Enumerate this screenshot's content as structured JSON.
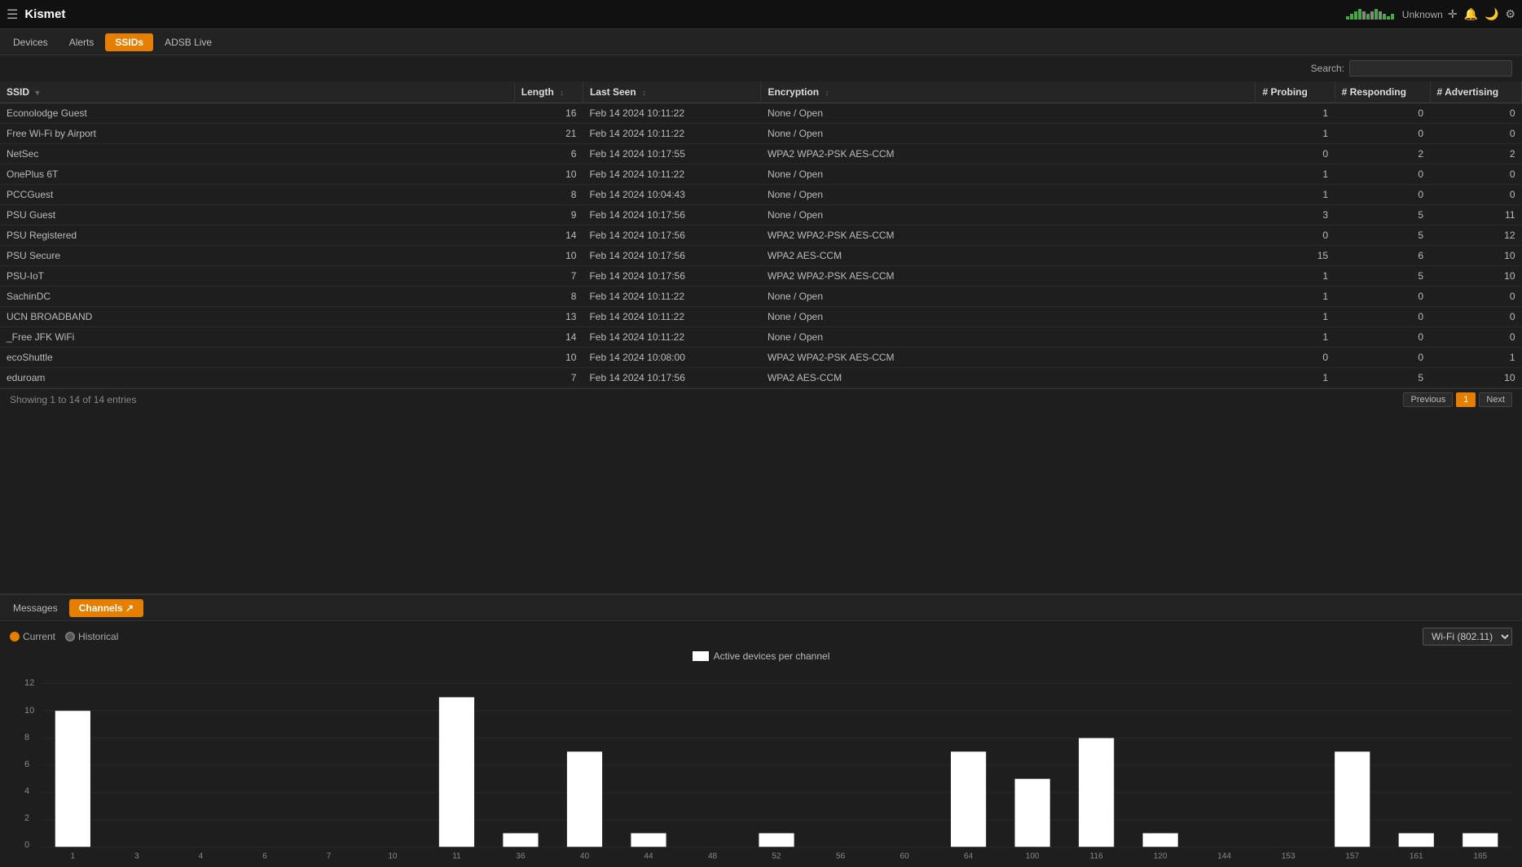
{
  "app": {
    "title": "Kismet",
    "unknown_label": "Unknown"
  },
  "nav": {
    "tabs": [
      {
        "id": "devices",
        "label": "Devices",
        "active": false
      },
      {
        "id": "alerts",
        "label": "Alerts",
        "active": false
      },
      {
        "id": "ssids",
        "label": "SSIDs",
        "active": true
      },
      {
        "id": "adsb",
        "label": "ADSB Live",
        "active": false
      }
    ]
  },
  "search": {
    "label": "Search:",
    "placeholder": ""
  },
  "table": {
    "columns": [
      "SSID",
      "Length",
      "Last Seen",
      "Encryption",
      "# Probing",
      "# Responding",
      "# Advertising"
    ],
    "rows": [
      {
        "ssid": "Econolodge Guest",
        "length": 16,
        "last_seen": "Feb 14 2024 10:11:22",
        "encryption": "None / Open",
        "probing": 1,
        "responding": 0,
        "advertising": 0
      },
      {
        "ssid": "Free Wi-Fi by Airport",
        "length": 21,
        "last_seen": "Feb 14 2024 10:11:22",
        "encryption": "None / Open",
        "probing": 1,
        "responding": 0,
        "advertising": 0
      },
      {
        "ssid": "NetSec",
        "length": 6,
        "last_seen": "Feb 14 2024 10:17:55",
        "encryption": "WPA2 WPA2-PSK AES-CCM",
        "probing": 0,
        "responding": 2,
        "advertising": 2
      },
      {
        "ssid": "OnePlus 6T",
        "length": 10,
        "last_seen": "Feb 14 2024 10:11:22",
        "encryption": "None / Open",
        "probing": 1,
        "responding": 0,
        "advertising": 0
      },
      {
        "ssid": "PCCGuest",
        "length": 8,
        "last_seen": "Feb 14 2024 10:04:43",
        "encryption": "None / Open",
        "probing": 1,
        "responding": 0,
        "advertising": 0
      },
      {
        "ssid": "PSU Guest",
        "length": 9,
        "last_seen": "Feb 14 2024 10:17:56",
        "encryption": "None / Open",
        "probing": 3,
        "responding": 5,
        "advertising": 11
      },
      {
        "ssid": "PSU Registered",
        "length": 14,
        "last_seen": "Feb 14 2024 10:17:56",
        "encryption": "WPA2 WPA2-PSK AES-CCM",
        "probing": 0,
        "responding": 5,
        "advertising": 12
      },
      {
        "ssid": "PSU Secure",
        "length": 10,
        "last_seen": "Feb 14 2024 10:17:56",
        "encryption": "WPA2 AES-CCM",
        "probing": 15,
        "responding": 6,
        "advertising": 10
      },
      {
        "ssid": "PSU-IoT",
        "length": 7,
        "last_seen": "Feb 14 2024 10:17:56",
        "encryption": "WPA2 WPA2-PSK AES-CCM",
        "probing": 1,
        "responding": 5,
        "advertising": 10
      },
      {
        "ssid": "SachinDC",
        "length": 8,
        "last_seen": "Feb 14 2024 10:11:22",
        "encryption": "None / Open",
        "probing": 1,
        "responding": 0,
        "advertising": 0
      },
      {
        "ssid": "UCN BROADBAND",
        "length": 13,
        "last_seen": "Feb 14 2024 10:11:22",
        "encryption": "None / Open",
        "probing": 1,
        "responding": 0,
        "advertising": 0
      },
      {
        "ssid": "_Free JFK WiFi",
        "length": 14,
        "last_seen": "Feb 14 2024 10:11:22",
        "encryption": "None / Open",
        "probing": 1,
        "responding": 0,
        "advertising": 0
      },
      {
        "ssid": "ecoShuttle",
        "length": 10,
        "last_seen": "Feb 14 2024 10:08:00",
        "encryption": "WPA2 WPA2-PSK AES-CCM",
        "probing": 0,
        "responding": 0,
        "advertising": 1
      },
      {
        "ssid": "eduroam",
        "length": 7,
        "last_seen": "Feb 14 2024 10:17:56",
        "encryption": "WPA2 AES-CCM",
        "probing": 1,
        "responding": 5,
        "advertising": 10
      }
    ]
  },
  "pagination": {
    "info": "Showing 1 to 14 of 14 entries",
    "prev_label": "Previous",
    "next_label": "Next",
    "current_page": "1"
  },
  "bottom": {
    "tabs": [
      {
        "id": "messages",
        "label": "Messages",
        "active": false
      },
      {
        "id": "channels",
        "label": "Channels ↗",
        "active": true
      }
    ],
    "chart_controls": {
      "current_label": "Current",
      "historical_label": "Historical",
      "wifi_option": "Wi-Fi (802.11)"
    },
    "legend": {
      "label": "Active devices per channel"
    }
  },
  "chart": {
    "y_max": 12,
    "y_labels": [
      0,
      2,
      4,
      6,
      8,
      10,
      12
    ],
    "bars": [
      {
        "channel": "1",
        "value": 10
      },
      {
        "channel": "3",
        "value": 0
      },
      {
        "channel": "4",
        "value": 0
      },
      {
        "channel": "6",
        "value": 0
      },
      {
        "channel": "7",
        "value": 0
      },
      {
        "channel": "10",
        "value": 0
      },
      {
        "channel": "11",
        "value": 11
      },
      {
        "channel": "36",
        "value": 1
      },
      {
        "channel": "40",
        "value": 7
      },
      {
        "channel": "44",
        "value": 1
      },
      {
        "channel": "48",
        "value": 0
      },
      {
        "channel": "52",
        "value": 1
      },
      {
        "channel": "56",
        "value": 0
      },
      {
        "channel": "60",
        "value": 0
      },
      {
        "channel": "64",
        "value": 7
      },
      {
        "channel": "100",
        "value": 5
      },
      {
        "channel": "116",
        "value": 8
      },
      {
        "channel": "120",
        "value": 1
      },
      {
        "channel": "144",
        "value": 0
      },
      {
        "channel": "153",
        "value": 0
      },
      {
        "channel": "157",
        "value": 7
      },
      {
        "channel": "161",
        "value": 1
      },
      {
        "channel": "165",
        "value": 1
      }
    ]
  }
}
